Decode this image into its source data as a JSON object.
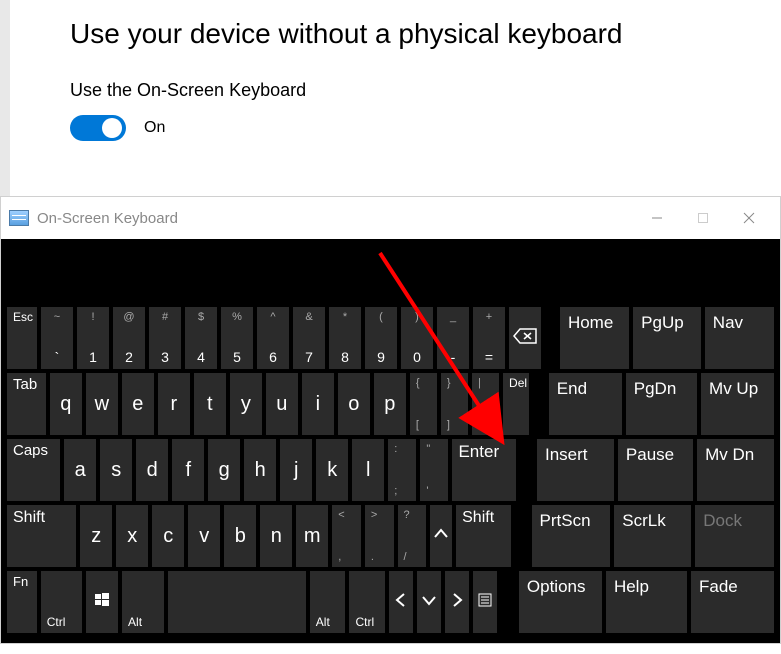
{
  "settings": {
    "heading": "Use your device without a physical keyboard",
    "subheading": "Use the On-Screen Keyboard",
    "toggle_state": "On"
  },
  "osk": {
    "title": "On-Screen Keyboard",
    "row1": {
      "esc": "Esc",
      "nums": [
        {
          "sup": "~",
          "main": "`"
        },
        {
          "sup": "!",
          "main": "1"
        },
        {
          "sup": "@",
          "main": "2"
        },
        {
          "sup": "#",
          "main": "3"
        },
        {
          "sup": "$",
          "main": "4"
        },
        {
          "sup": "%",
          "main": "5"
        },
        {
          "sup": "^",
          "main": "6"
        },
        {
          "sup": "&",
          "main": "7"
        },
        {
          "sup": "*",
          "main": "8"
        },
        {
          "sup": "(",
          "main": "9"
        },
        {
          "sup": ")",
          "main": "0"
        },
        {
          "sup": "_",
          "main": "-"
        },
        {
          "sup": "+",
          "main": "="
        }
      ]
    },
    "row2": {
      "tab": "Tab",
      "letters": [
        "q",
        "w",
        "e",
        "r",
        "t",
        "y",
        "u",
        "i",
        "o",
        "p"
      ],
      "bracket1": {
        "sup": "{",
        "sub": "["
      },
      "bracket2": {
        "sup": "}",
        "sub": "]"
      },
      "slash": {
        "sup": "|",
        "sub": "\\"
      },
      "del": "Del"
    },
    "row3": {
      "caps": "Caps",
      "letters": [
        "a",
        "s",
        "d",
        "f",
        "g",
        "h",
        "j",
        "k",
        "l"
      ],
      "semi": {
        "sup": ":",
        "sub": ";"
      },
      "quote": {
        "sup": "\"",
        "sub": "'"
      },
      "enter": "Enter"
    },
    "row4": {
      "shiftL": "Shift",
      "letters": [
        "z",
        "x",
        "c",
        "v",
        "b",
        "n",
        "m"
      ],
      "comma": {
        "sup": "<",
        "sub": ","
      },
      "period": {
        "sup": ">",
        "sub": "."
      },
      "qmark": {
        "sup": "?",
        "sub": "/"
      },
      "shiftR": "Shift"
    },
    "row5": {
      "fn": "Fn",
      "ctrlL": "Ctrl",
      "altL": "Alt",
      "altR": "Alt",
      "ctrlR": "Ctrl"
    },
    "nav": {
      "r1": [
        "Home",
        "PgUp",
        "Nav"
      ],
      "r2": [
        "End",
        "PgDn",
        "Mv Up"
      ],
      "r3": [
        "Insert",
        "Pause",
        "Mv Dn"
      ],
      "r4": [
        "PrtScn",
        "ScrLk",
        "Dock"
      ],
      "r5": [
        "Options",
        "Help",
        "Fade"
      ]
    }
  }
}
